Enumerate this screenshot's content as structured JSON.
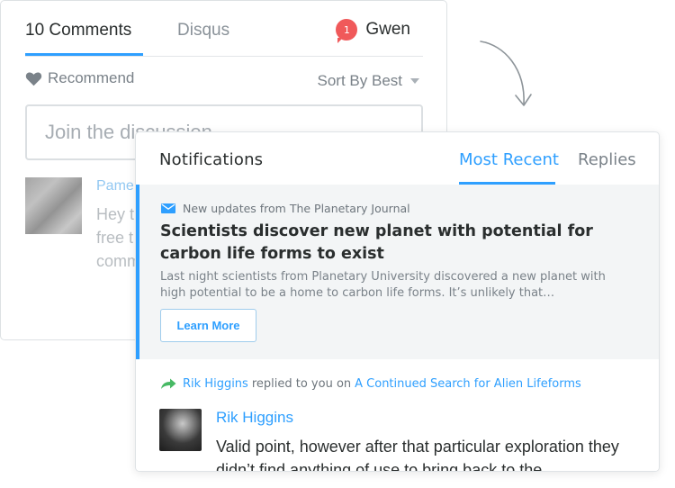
{
  "comments_panel": {
    "tab_comments": "10 Comments",
    "tab_disqus": "Disqus",
    "user": {
      "badge_count": "1",
      "name": "Gwen"
    },
    "recommend_label": "Recommend",
    "sort_label": "Sort By Best",
    "input_placeholder": "Join the discussion...",
    "comment": {
      "author": "Pame",
      "text": "Hey t\nfree t\ncomm"
    }
  },
  "notifications": {
    "title": "Notifications",
    "tabs": [
      {
        "label": "Most Recent",
        "active": true
      },
      {
        "label": "Replies",
        "active": false
      }
    ],
    "items": [
      {
        "icon": "envelope-icon",
        "source": "New updates from The Planetary Journal",
        "headline": "Scientists discover new planet with potential for carbon life forms to exist",
        "excerpt": "Last night scientists from Planetary University discovered a new planet with high potential to be a home to carbon life forms. It’s unlikely that…",
        "button_label": "Learn More"
      },
      {
        "icon": "reply-arrow-icon",
        "actor": "Rik Higgins",
        "action_text": "replied to you on",
        "thread_title": "A Continued Search for Alien Lifeforms",
        "author": "Rik Higgins",
        "text": "Valid point, however after that particular exploration they didn’t find anything of use to bring back to the"
      }
    ]
  },
  "colors": {
    "accent": "#2e9fff",
    "badge": "#f0595a",
    "text_primary": "#2a2e2e",
    "text_muted": "#7a8289",
    "highlight_bg": "#f3f5f6"
  }
}
